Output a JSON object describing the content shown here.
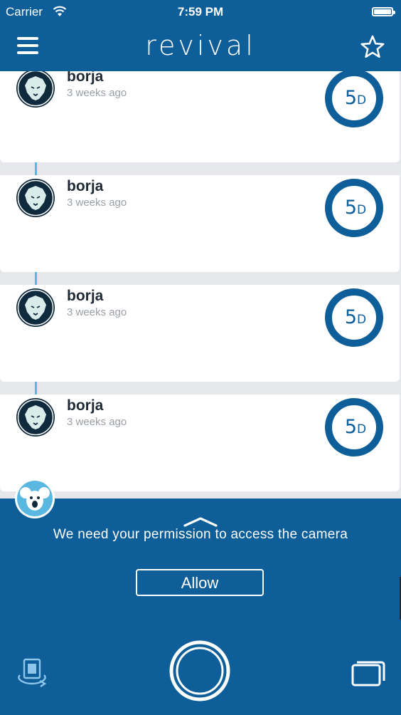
{
  "status_bar": {
    "carrier": "Carrier",
    "time": "7:59 PM"
  },
  "header": {
    "logo": "revival"
  },
  "feed": {
    "items": [
      {
        "username": "borja",
        "time_ago": "3 weeks ago",
        "days_badge": "5",
        "days_unit": "D"
      },
      {
        "username": "borja",
        "time_ago": "3 weeks ago",
        "days_badge": "5",
        "days_unit": "D"
      },
      {
        "username": "borja",
        "time_ago": "3 weeks ago",
        "days_badge": "5",
        "days_unit": "D"
      },
      {
        "username": "borja",
        "time_ago": "3 weeks ago",
        "days_badge": "5",
        "days_unit": "D"
      }
    ]
  },
  "camera_panel": {
    "permission_text": "We need your permission to access the camera",
    "allow_label": "Allow"
  },
  "icons": {
    "menu": "hamburger-menu-icon",
    "favorite": "star-icon",
    "avatar": "lion-icon",
    "profile": "koala-icon",
    "flip_camera": "flip-camera-icon",
    "shutter": "shutter-icon",
    "gallery": "gallery-icon",
    "expand": "chevron-up-icon"
  },
  "colors": {
    "brand": "#0d5e99",
    "accent": "#5ab8e0",
    "avatar_bg": "#0f2a3d",
    "lion": "#d9ecea"
  }
}
